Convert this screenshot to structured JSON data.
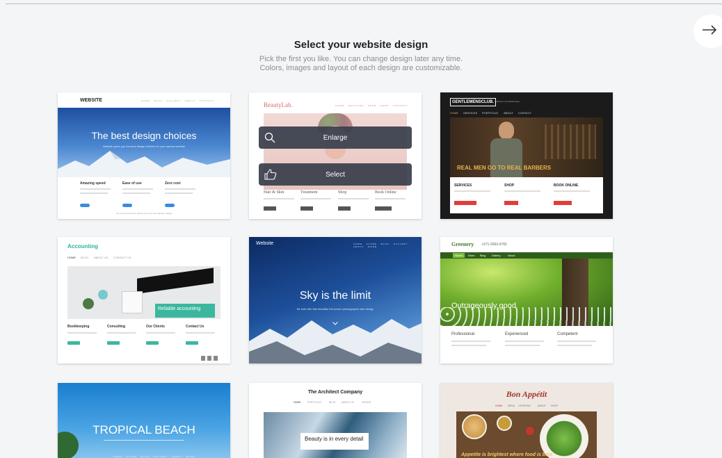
{
  "header": {
    "title": "Select your website design",
    "subtitle_line1": "Pick the first you like. You can change design later any time.",
    "subtitle_line2": "Colors, images and layout of each design are customizable.",
    "next_icon": "arrow-right-icon"
  },
  "overlay": {
    "enlarge_label": "Enlarge",
    "select_label": "Select",
    "enlarge_icon": "search-icon",
    "select_icon": "thumbs-up-icon"
  },
  "templates": {
    "website": {
      "logo": "WEBSITE",
      "headline": "The best design choices",
      "tagline": "Website gives you the best design choices for your special website",
      "cols": [
        "Amazing speed",
        "Ease of use",
        "Zero cost"
      ],
      "footer": "You can put it into any theme your very own website in Easy!"
    },
    "beautylab": {
      "logo": "BeautyLab.",
      "cols": [
        "Hair & Skin",
        "Treatment",
        "Shop",
        "Book Online"
      ]
    },
    "gentlemens": {
      "logo": "GENTLEMENSCLUB.",
      "tag": "Call Get Your Barbershop",
      "nav": [
        "HOME",
        "SERVICES",
        "PORTFOLIO",
        "ABOUT",
        "CONTACT"
      ],
      "headline": "REAL MEN GO TO REAL BARBERS",
      "cols": [
        "SERVICES",
        "SHOP",
        "BOOK ONLINE"
      ]
    },
    "accounting": {
      "logo": "Accounting",
      "nav": [
        "HOME",
        "BLOG",
        "ABOUT US",
        "CONTACT US"
      ],
      "banner": "Reliable accounting",
      "cols": [
        "Bookkeeping",
        "Consulting",
        "Our Clients",
        "Contact Us"
      ]
    },
    "sky": {
      "logo": "Website",
      "headline": "Sky is the limit",
      "tagline": "Be bold with this beautiful full screen photographic web design"
    },
    "greenery": {
      "logo": "Greenery",
      "phone": "+371-2663-6765",
      "nav": [
        "Home",
        "Store",
        "Blog",
        "Gallery",
        "About"
      ],
      "headline": "Outrageously good",
      "cols": [
        "Professional",
        "Experienced",
        "Competent"
      ]
    },
    "tropical": {
      "headline": "TROPICAL BEACH"
    },
    "architect": {
      "logo": "The Architect Company",
      "nav": [
        "HOME",
        "PORTFOLIO",
        "BLOG",
        "ABOUT US",
        "VIDEOS"
      ],
      "banner": "Beauty is in every detail"
    },
    "bonappetit": {
      "logo": "Bon Appétit",
      "nav": [
        "HOME",
        "MENU",
        "CATERING",
        "ABOUT",
        "SHOP"
      ],
      "banner": "Appetite is brightest where food is best"
    }
  }
}
